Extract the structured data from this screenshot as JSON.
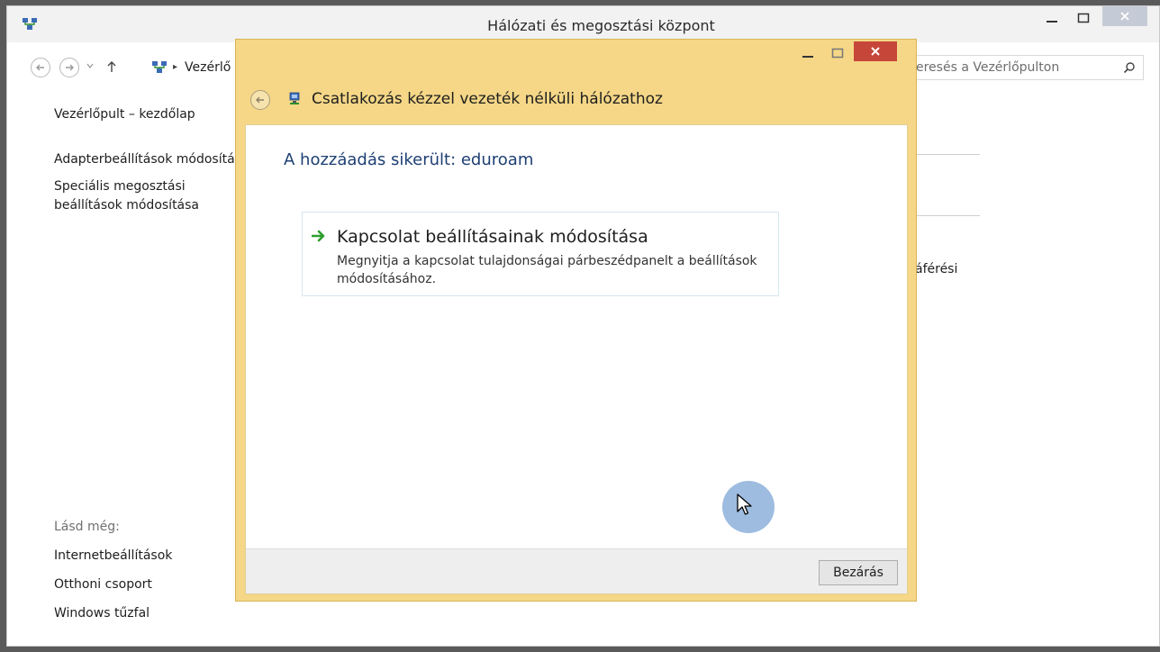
{
  "main_window": {
    "title": "Hálózati és megosztási központ",
    "breadcrumb": "Vezérlő",
    "search_placeholder": "eresés a Vezérlőpulton",
    "left_nav": {
      "home": "Vezérlőpult – kezdőlap",
      "adapter": "Adapterbeállítások módosítá",
      "sharing_line1": "Speciális megosztási",
      "sharing_line2": "beállítások módosítása"
    },
    "see_also": {
      "heading": "Lásd még:",
      "items": [
        "Internetbeállítások",
        "Otthoni csoport",
        "Windows tűzfal"
      ]
    },
    "right_fragment": "áférési"
  },
  "dialog": {
    "title": "Csatlakozás kézzel vezeték nélküli hálózathoz",
    "success_message": "A hozzáadás sikerült: eduroam",
    "option": {
      "title": "Kapcsolat beállításainak módosítása",
      "description": "Megnyitja a kapcsolat tulajdonságai párbeszédpanelt a beállítások módosításához."
    },
    "close_label": "Bezárás"
  },
  "colors": {
    "dialog_frame": "#f5d787",
    "dialog_close": "#c7463a",
    "success_text": "#1e3f73",
    "option_arrow": "#2e9e2e",
    "cursor_halo": "#7ca5d6"
  }
}
